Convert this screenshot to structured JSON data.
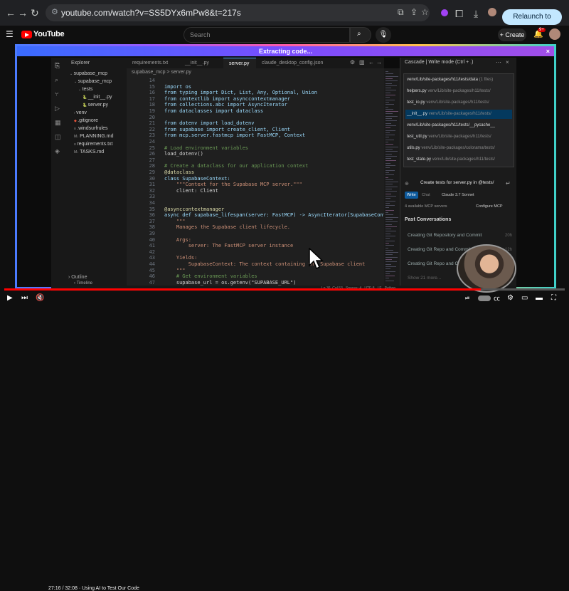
{
  "browser": {
    "url": "youtube.com/watch?v=SS5DYx6mPw8&t=217s",
    "relaunch_label": "Relaunch to update"
  },
  "youtube": {
    "brand": "YouTube",
    "search_placeholder": "Search",
    "create_label": "Create",
    "notif_count": "9+"
  },
  "overlay": {
    "banner": "Extracting code..."
  },
  "ide": {
    "explorer_title": "Explorer",
    "tree": [
      {
        "label": "supabase_mcp",
        "indent": 0,
        "icon": "chevron-down"
      },
      {
        "label": "supabase_mcp",
        "indent": 1,
        "icon": "chevron-down"
      },
      {
        "label": "tests",
        "indent": 2,
        "icon": "chevron-down"
      },
      {
        "label": "__init__.py",
        "indent": 3,
        "icon": "python"
      },
      {
        "label": "server.py",
        "indent": 3,
        "icon": "python"
      },
      {
        "label": "venv",
        "indent": 1,
        "icon": "chevron-right"
      },
      {
        "label": ".gitignore",
        "indent": 1,
        "icon": "git"
      },
      {
        "label": ".windsurfrules",
        "indent": 1,
        "icon": "file"
      },
      {
        "label": "PLANNING.md",
        "indent": 1,
        "icon": "markdown"
      },
      {
        "label": "requirements.txt",
        "indent": 1,
        "icon": "text"
      },
      {
        "label": "TASKS.md",
        "indent": 1,
        "icon": "markdown"
      }
    ],
    "outline_label": "Outline",
    "timeline_label": "Timeline",
    "tabs": [
      {
        "label": "requirements.txt",
        "active": false
      },
      {
        "label": "__init__.py",
        "active": false
      },
      {
        "label": "server.py",
        "active": true
      },
      {
        "label": "claude_desktop_config.json",
        "active": false
      }
    ],
    "breadcrumb": "supabase_mcp > server.py",
    "code_lines": [
      {
        "n": "14",
        "t": ""
      },
      {
        "n": "15",
        "t": "import os"
      },
      {
        "n": "16",
        "t": "from typing import Dict, List, Any, Optional, Union"
      },
      {
        "n": "17",
        "t": "from contextlib import asynccontextmanager"
      },
      {
        "n": "18",
        "t": "from collections.abc import AsyncIterator"
      },
      {
        "n": "19",
        "t": "from dataclasses import dataclass"
      },
      {
        "n": "20",
        "t": ""
      },
      {
        "n": "21",
        "t": "from dotenv import load_dotenv"
      },
      {
        "n": "22",
        "t": "from supabase import create_client, Client"
      },
      {
        "n": "23",
        "t": "from mcp.server.fastmcp import FastMCP, Context"
      },
      {
        "n": "24",
        "t": ""
      },
      {
        "n": "25",
        "t": "# Load environment variables"
      },
      {
        "n": "26",
        "t": "load_dotenv()"
      },
      {
        "n": "27",
        "t": ""
      },
      {
        "n": "28",
        "t": "# Create a dataclass for our application context"
      },
      {
        "n": "29",
        "t": "@dataclass"
      },
      {
        "n": "30",
        "t": "class SupabaseContext:"
      },
      {
        "n": "31",
        "t": "    \"\"\"Context for the Supabase MCP server.\"\"\""
      },
      {
        "n": "32",
        "t": "    client: Client"
      },
      {
        "n": "33",
        "t": ""
      },
      {
        "n": "34",
        "t": ""
      },
      {
        "n": "35",
        "t": "@asynccontextmanager"
      },
      {
        "n": "36",
        "t": "async def supabase_lifespan(server: FastMCP) -> AsyncIterator[SupabaseContext]:"
      },
      {
        "n": "37",
        "t": "    \"\"\""
      },
      {
        "n": "38",
        "t": "    Manages the Supabase client lifecycle."
      },
      {
        "n": "39",
        "t": ""
      },
      {
        "n": "40",
        "t": "    Args:"
      },
      {
        "n": "41",
        "t": "        server: The FastMCP server instance"
      },
      {
        "n": "42",
        "t": ""
      },
      {
        "n": "43",
        "t": "    Yields:"
      },
      {
        "n": "44",
        "t": "        SupabaseContext: The context containing the Supabase client"
      },
      {
        "n": "45",
        "t": "    \"\"\""
      },
      {
        "n": "46",
        "t": "    # Get environment variables"
      },
      {
        "n": "47",
        "t": "    supabase_url = os.getenv(\"SUPABASE_URL\")"
      }
    ],
    "cascade": {
      "title": "Cascade | Write mode (Ctrl + .)",
      "files": [
        {
          "name": "venv/Lib/site-packages/h11/tests/data",
          "path": "(1 files)",
          "selected": false
        },
        {
          "name": "helpers.py",
          "path": "venv/Lib/site-packages/h11/tests/",
          "selected": false
        },
        {
          "name": "test_io.py",
          "path": "venv/Lib/site-packages/h11/tests/",
          "selected": false
        },
        {
          "name": "__init__.py",
          "path": "venv/Lib/site-packages/h11/tests/",
          "selected": true
        },
        {
          "name": "venv/Lib/site-packages/h11/tests/__pycache__",
          "path": "",
          "selected": false
        },
        {
          "name": "test_util.py",
          "path": "venv/Lib/site-packages/h11/tests/",
          "selected": false
        },
        {
          "name": "utils.py",
          "path": "venv/Lib/site-packages/colorama/tests/",
          "selected": false
        },
        {
          "name": "test_state.py",
          "path": "venv/Lib/site-packages/h11/tests/",
          "selected": false
        }
      ],
      "prompt": "Create tests for server.py in @tests/",
      "write_label": "Write",
      "chat_label": "Chat",
      "model_label": "Claude 3.7 Sonnet",
      "mcp_servers": "4 available MCP servers",
      "configure_mcp": "Configure MCP",
      "past_title": "Past Conversations",
      "conversations": [
        {
          "title": "Creating Git Repository and Commit",
          "time": "20h"
        },
        {
          "title": "Creating Git Repo and Commit",
          "time": "12h"
        },
        {
          "title": "Creating Git Repo and Commit",
          "time": ""
        }
      ],
      "show_more": "Show 21 more..."
    },
    "status": "Ln 36, Col 53   Spaces: 4   UTF-8   LF   Python"
  },
  "player": {
    "time": "27:16 / 32:08",
    "chapter": "· Using AI to Test Our Code",
    "progress": 0.85
  },
  "colors": {
    "accent": "#4daafc",
    "yt_red": "#ff0000",
    "keyword": "#c586c0",
    "builtin": "#569cd6",
    "string": "#ce9178",
    "comment": "#6a9955"
  }
}
